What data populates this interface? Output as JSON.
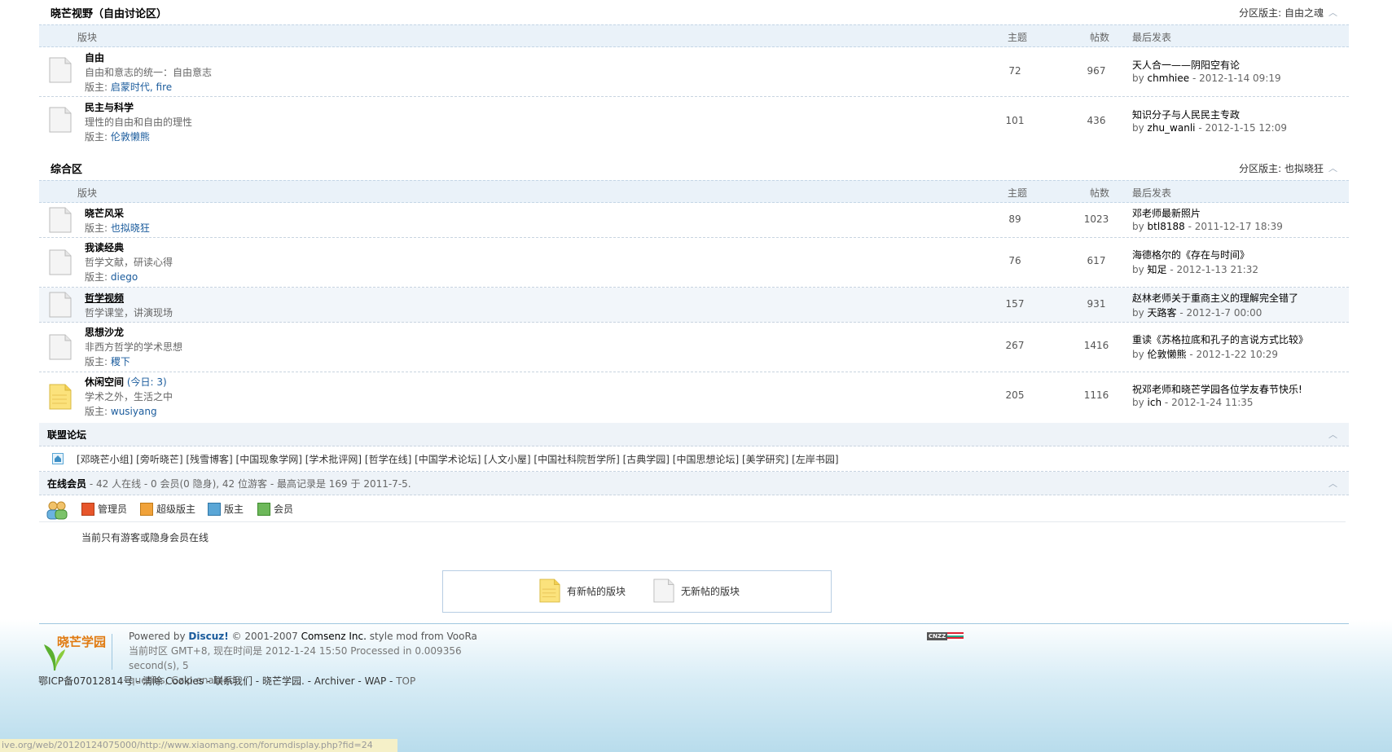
{
  "columns": {
    "forum": "版块",
    "topics": "主题",
    "posts": "帖数",
    "lastpost": "最后发表"
  },
  "cat1": {
    "title": "晓芒视野（自由讨论区）",
    "moderator": "分区版主: 自由之魂",
    "forums": [
      {
        "name": "自由",
        "desc": "自由和意志的统一：自由意志",
        "mod_label": "版主:",
        "mods": "启蒙时代, fire",
        "topics": "72",
        "posts": "967",
        "last_title": "天人合一——阴阳空有论",
        "last_by": "by",
        "last_user": "chmhiee",
        "last_time": "- 2012-1-14 09:19"
      },
      {
        "name": "民主与科学",
        "desc": "理性的自由和自由的理性",
        "mod_label": "版主:",
        "mods": "伦敦懒熊",
        "topics": "101",
        "posts": "436",
        "last_title": "知识分子与人民民主专政",
        "last_by": "by",
        "last_user": "zhu_wanli",
        "last_time": "- 2012-1-15 12:09"
      }
    ]
  },
  "cat2": {
    "title": "综合区",
    "moderator": "分区版主: 也拟晓狂",
    "forums": [
      {
        "name": "晓芒风采",
        "desc": "",
        "mod_label": "版主:",
        "mods": "也拟晓狂",
        "topics": "89",
        "posts": "1023",
        "last_title": "邓老师最新照片",
        "last_by": "by",
        "last_user": "btl8188",
        "last_time": "- 2011-12-17 18:39"
      },
      {
        "name": "我读经典",
        "desc": "哲学文献，研读心得",
        "mod_label": "版主:",
        "mods": "diego",
        "topics": "76",
        "posts": "617",
        "last_title": "海德格尔的《存在与时间》",
        "last_by": "by",
        "last_user": "知足",
        "last_time": "- 2012-1-13 21:32"
      },
      {
        "name": "哲学视频",
        "desc": "哲学课堂，讲演现场",
        "mod_label": "",
        "mods": "",
        "topics": "157",
        "posts": "931",
        "last_title": "赵林老师关于重商主义的理解完全错了",
        "last_by": "by",
        "last_user": "天路客",
        "last_time": "- 2012-1-7 00:00"
      },
      {
        "name": "思想沙龙",
        "desc": "非西方哲学的学术思想",
        "mod_label": "版主:",
        "mods": "稷下",
        "topics": "267",
        "posts": "1416",
        "last_title": "重读《苏格拉底和孔子的言说方式比较》",
        "last_by": "by",
        "last_user": "伦敦懒熊",
        "last_time": "- 2012-1-22 10:29"
      },
      {
        "name": "休闲空间",
        "today": "(今日: 3)",
        "desc": "学术之外，生活之中",
        "mod_label": "版主:",
        "mods": "wusiyang",
        "topics": "205",
        "posts": "1116",
        "last_title": "祝邓老师和晓芒学园各位学友春节快乐!",
        "last_by": "by",
        "last_user": "ich",
        "last_time": "- 2012-1-24 11:35"
      }
    ]
  },
  "links": {
    "title": "联盟论坛",
    "text": "[邓晓芒小组] [旁听晓芒] [残雪博客] [中国现象学网] [学术批评网] [哲学在线] [中国学术论坛] [人文小屋] [中国社科院哲学所] [古典学园] [中国思想论坛] [美学研究] [左岸书园]"
  },
  "online": {
    "title": "在线会员",
    "summary": "- 42 人在线 - 0 会员(0 隐身), 42 位游客 - 最高记录是 169 于 2011-7-5.",
    "roles": [
      "管理员",
      "超级版主",
      "版主",
      "会员"
    ],
    "note": "当前只有游客或隐身会员在线"
  },
  "legend": {
    "new": "有新帖的版块",
    "nonew": "无新帖的版块"
  },
  "footer": {
    "logo": "晓芒学园",
    "powered_pre": "Powered by ",
    "powered_brand": "Discuz!",
    "powered_post": " © 2001-2007 ",
    "company": "Comsenz Inc.",
    "style": " style mod from VooRa",
    "timezone": "当前时区 GMT+8, 现在时间是 2012-1-24 15:50 Processed in 0.009356 second(s), 5",
    "queries": "queries, Gzip enabled.",
    "links": [
      "鄂ICP备07012814号",
      "清除 Cookies",
      "联系我们",
      "晓芒学园.",
      "Archiver",
      "WAP",
      "TOP"
    ],
    "cnzz": "CNZZ"
  },
  "status_url": "ive.org/web/20120124075000/http://www.xiaomang.com/forumdisplay.php?fid=24"
}
